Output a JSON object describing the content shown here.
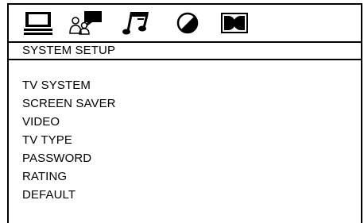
{
  "tabs": [
    {
      "icon": "monitor-icon",
      "active": true
    },
    {
      "icon": "people-speech-icon",
      "active": false
    },
    {
      "icon": "music-note-icon",
      "active": false
    },
    {
      "icon": "contrast-circle-icon",
      "active": false
    },
    {
      "icon": "dolby-icon",
      "active": false
    }
  ],
  "section": {
    "title": "SYSTEM SETUP"
  },
  "menu": {
    "items": [
      {
        "label": "TV SYSTEM"
      },
      {
        "label": "SCREEN SAVER"
      },
      {
        "label": "VIDEO"
      },
      {
        "label": "TV TYPE"
      },
      {
        "label": "PASSWORD"
      },
      {
        "label": "RATING"
      },
      {
        "label": "DEFAULT"
      }
    ]
  }
}
